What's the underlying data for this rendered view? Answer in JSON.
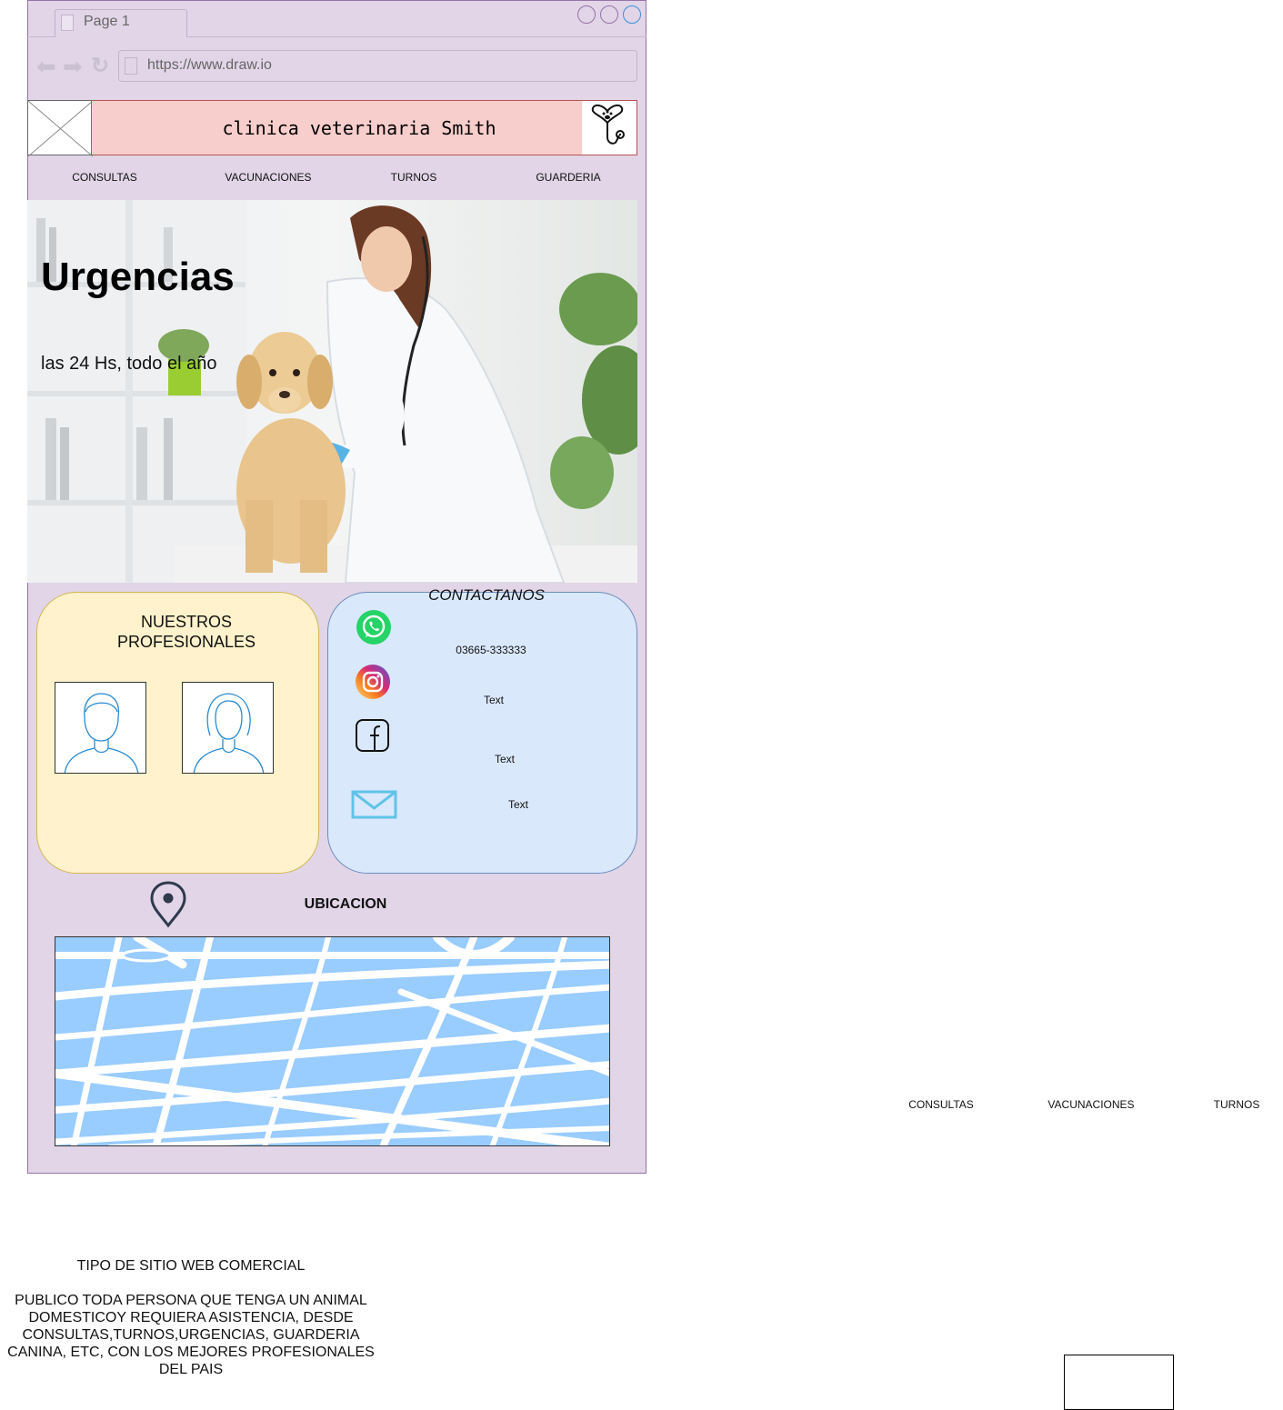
{
  "browser": {
    "tab_label": "Page 1",
    "url": "https://www.draw.io"
  },
  "header": {
    "site_title": "clinica veterinaria Smith"
  },
  "nav": {
    "items": [
      "CONSULTAS",
      "VACUNACIONES",
      "TURNOS",
      "GUARDERIA"
    ]
  },
  "hero": {
    "title": "Urgencias",
    "subtitle": "las 24 Hs, todo el año"
  },
  "professionals": {
    "title": "NUESTROS PROFESIONALES"
  },
  "contact": {
    "title": "CONTACTANOS",
    "items": [
      {
        "icon": "whatsapp-icon",
        "text": "03665-333333"
      },
      {
        "icon": "instagram-icon",
        "text": "Text"
      },
      {
        "icon": "facebook-icon",
        "text": "Text"
      },
      {
        "icon": "mail-icon",
        "text": "Text"
      }
    ]
  },
  "location": {
    "title": "UBICACION"
  },
  "external_nav": {
    "items": [
      "CONSULTAS",
      "VACUNACIONES",
      "TURNOS"
    ]
  },
  "notes": {
    "site_type": "TIPO DE SITIO WEB COMERCIAL",
    "audience": "PUBLICO TODA PERSONA QUE TENGA UN ANIMAL DOMESTICOY REQUIERA ASISTENCIA, DESDE CONSULTAS,TURNOS,URGENCIAS, GUARDERIA CANINA, ETC, CON LOS MEJORES PROFESIONALES DEL PAIS"
  },
  "colors": {
    "frame": "#e1d5e7",
    "title_bar": "#f8cecc",
    "professionals_card": "#fff2cc",
    "contact_card": "#dae8fc",
    "map_water": "#99ccff"
  }
}
